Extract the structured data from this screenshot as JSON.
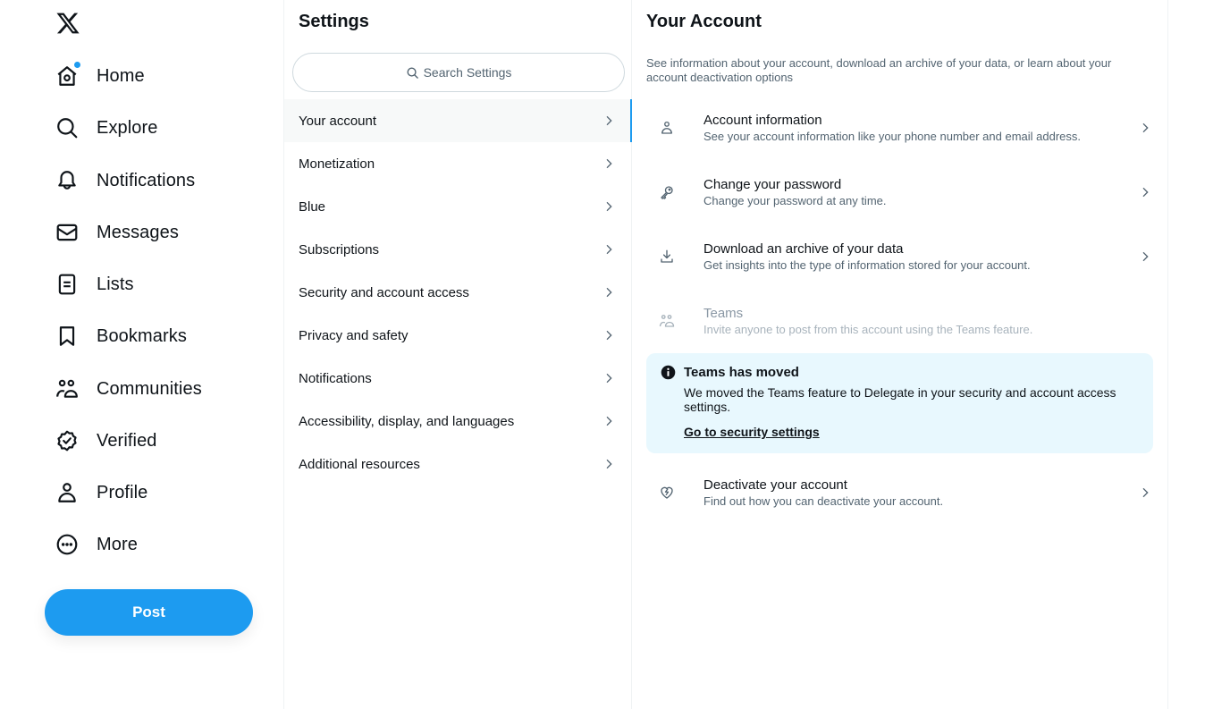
{
  "colors": {
    "accent": "#1d9bf0",
    "text_primary": "#0f1419",
    "text_secondary": "#536471",
    "notice_bg": "#e8f8fe",
    "active_bg": "#f7f9f9"
  },
  "logo": {
    "icon": "x-logo-icon"
  },
  "nav": {
    "items": [
      {
        "label": "Home",
        "icon": "home-icon",
        "has_badge": true
      },
      {
        "label": "Explore",
        "icon": "search-icon"
      },
      {
        "label": "Notifications",
        "icon": "bell-icon"
      },
      {
        "label": "Messages",
        "icon": "envelope-icon"
      },
      {
        "label": "Lists",
        "icon": "list-icon"
      },
      {
        "label": "Bookmarks",
        "icon": "bookmark-icon"
      },
      {
        "label": "Communities",
        "icon": "communities-icon"
      },
      {
        "label": "Verified",
        "icon": "verified-badge-icon"
      },
      {
        "label": "Profile",
        "icon": "person-icon"
      },
      {
        "label": "More",
        "icon": "more-circle-icon"
      }
    ],
    "post_label": "Post"
  },
  "settings": {
    "title": "Settings",
    "search_placeholder": "Search Settings",
    "items": [
      {
        "label": "Your account",
        "active": true
      },
      {
        "label": "Monetization"
      },
      {
        "label": "Blue"
      },
      {
        "label": "Subscriptions"
      },
      {
        "label": "Security and account access"
      },
      {
        "label": "Privacy and safety"
      },
      {
        "label": "Notifications"
      },
      {
        "label": "Accessibility, display, and languages"
      },
      {
        "label": "Additional resources"
      }
    ]
  },
  "account": {
    "title": "Your Account",
    "description": "See information about your account, download an archive of your data, or learn about your account deactivation options",
    "options": [
      {
        "title": "Account information",
        "subtitle": "See your account information like your phone number and email address.",
        "icon": "person-icon"
      },
      {
        "title": "Change your password",
        "subtitle": "Change your password at any time.",
        "icon": "key-icon"
      },
      {
        "title": "Download an archive of your data",
        "subtitle": "Get insights into the type of information stored for your account.",
        "icon": "download-icon"
      },
      {
        "title": "Teams",
        "subtitle": "Invite anyone to post from this account using the Teams feature.",
        "icon": "teams-icon",
        "disabled": true
      },
      {
        "title": "Deactivate your account",
        "subtitle": "Find out how you can deactivate your account.",
        "icon": "broken-heart-icon"
      }
    ],
    "notice": {
      "title": "Teams has moved",
      "body": "We moved the Teams feature to Delegate in your security and account access settings.",
      "link": "Go to security settings"
    }
  }
}
